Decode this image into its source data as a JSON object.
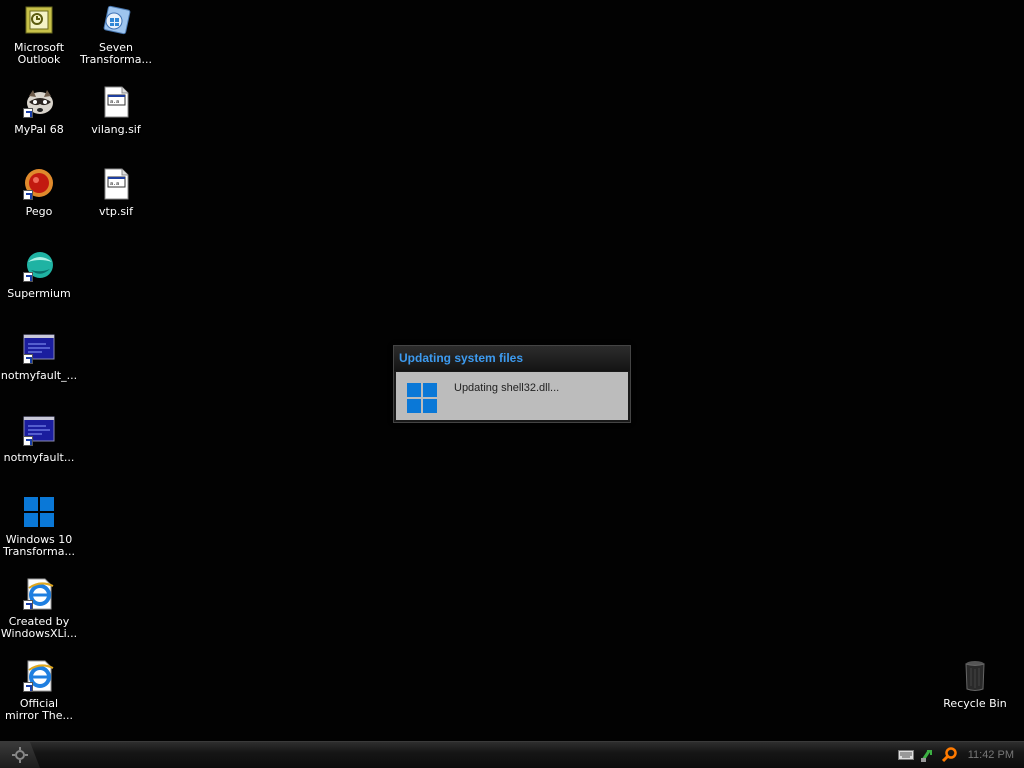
{
  "desktop": {
    "icons": [
      {
        "label": "Microsoft\nOutlook",
        "icon": "outlook-icon"
      },
      {
        "label": "Seven\nTransforma...",
        "icon": "seven-transformation-icon"
      },
      {
        "label": "MyPal 68",
        "icon": "mypal-icon"
      },
      {
        "label": "vilang.sif",
        "icon": "sif-file-icon"
      },
      {
        "label": "Pego",
        "icon": "pego-icon"
      },
      {
        "label": "vtp.sif",
        "icon": "sif-file-icon"
      },
      {
        "label": "Supermium",
        "icon": "supermium-icon"
      },
      {
        "label": "notmyfault_...",
        "icon": "notmyfault-icon"
      },
      {
        "label": "notmyfault...",
        "icon": "notmyfault-icon"
      },
      {
        "label": "Windows 10\nTransforma...",
        "icon": "windows-logo-icon"
      },
      {
        "label": "Created by\nWindowsXLi...",
        "icon": "internet-explorer-icon"
      },
      {
        "label": "Official\nmirror The...",
        "icon": "internet-explorer-icon"
      },
      {
        "label": "Recycle Bin",
        "icon": "recycle-bin-icon"
      }
    ]
  },
  "dialog": {
    "title": "Updating system files",
    "message": "Updating shell32.dll..."
  },
  "taskbar": {
    "clock": "11:42 PM"
  },
  "colors": {
    "desktop_bg": "#020202",
    "dialog_title": "#3d9bf0",
    "windows_blue": "#0a78d7"
  }
}
